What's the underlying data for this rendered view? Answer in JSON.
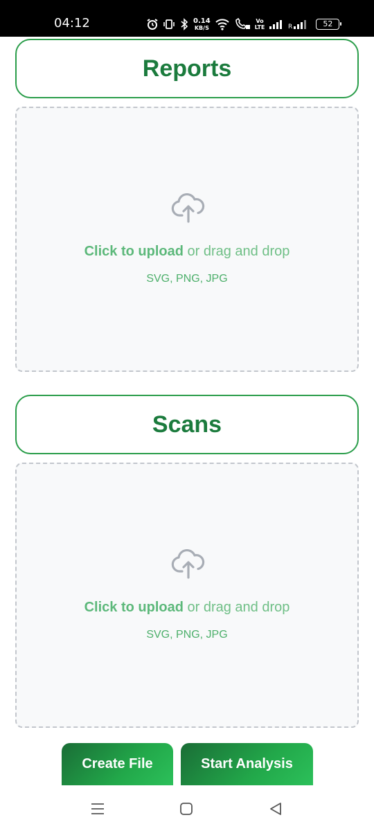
{
  "status_bar": {
    "time": "04:12",
    "net_speed_value": "0.14",
    "net_speed_unit": "KB/S",
    "volte_top": "Vo",
    "volte_bottom": "LTE",
    "battery": "52",
    "icons": [
      "alarm-icon",
      "vibrate-icon",
      "bluetooth-icon",
      "wifi-icon",
      "wifi-calling-icon",
      "signal-icon",
      "signal-roaming-icon",
      "battery-icon"
    ]
  },
  "sections": [
    {
      "title": "Reports",
      "upload_link": "Click to upload",
      "upload_rest": " or drag and drop",
      "formats": "SVG, PNG, JPG"
    },
    {
      "title": "Scans",
      "upload_link": "Click to upload",
      "upload_rest": " or drag and drop",
      "formats": "SVG, PNG, JPG"
    }
  ],
  "actions": {
    "create_file": "Create File",
    "start_analysis": "Start Analysis"
  },
  "nav": [
    "menu-icon",
    "home-icon",
    "back-icon"
  ],
  "colors": {
    "accent": "#2a9d4a",
    "title": "#1b7b3d",
    "upload_text": "#5cb87a",
    "dropzone_border": "#c2c6cc"
  }
}
